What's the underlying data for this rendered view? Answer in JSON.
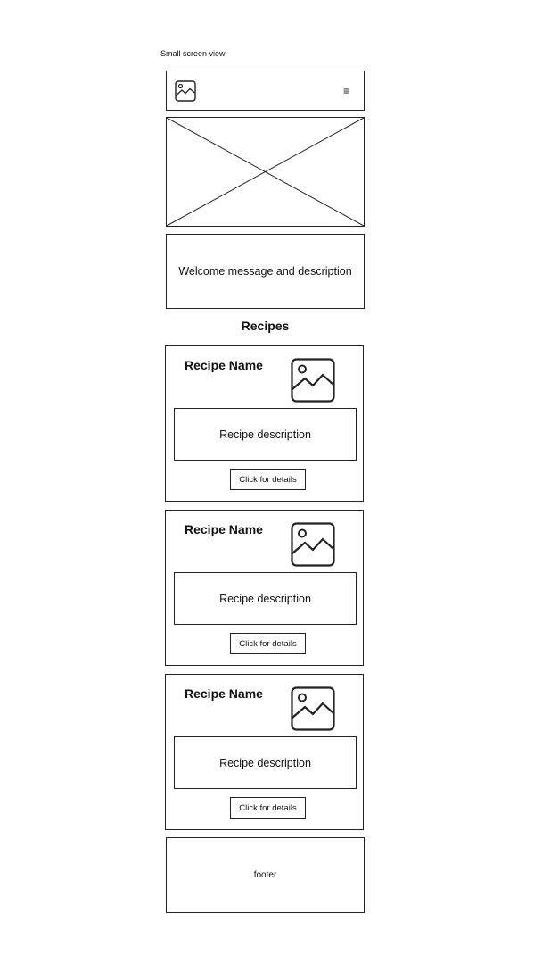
{
  "caption": "Small screen view",
  "header": {
    "logo_icon": "image-placeholder-icon",
    "menu_icon": "hamburger-menu-icon",
    "menu_glyph": "≡"
  },
  "hero": {
    "icon": "image-placeholder-cross"
  },
  "welcome": {
    "text": "Welcome message and description"
  },
  "recipes": {
    "title": "Recipes",
    "cards": [
      {
        "name": "Recipe Name",
        "description": "Recipe description",
        "button_label": "Click for details",
        "image_icon": "image-placeholder-icon"
      },
      {
        "name": "Recipe Name",
        "description": "Recipe description",
        "button_label": "Click for details",
        "image_icon": "image-placeholder-icon"
      },
      {
        "name": "Recipe Name",
        "description": "Recipe description",
        "button_label": "Click for details",
        "image_icon": "image-placeholder-icon"
      }
    ]
  },
  "footer": {
    "text": "footer"
  },
  "colors": {
    "line": "#222222",
    "background": "#ffffff"
  }
}
